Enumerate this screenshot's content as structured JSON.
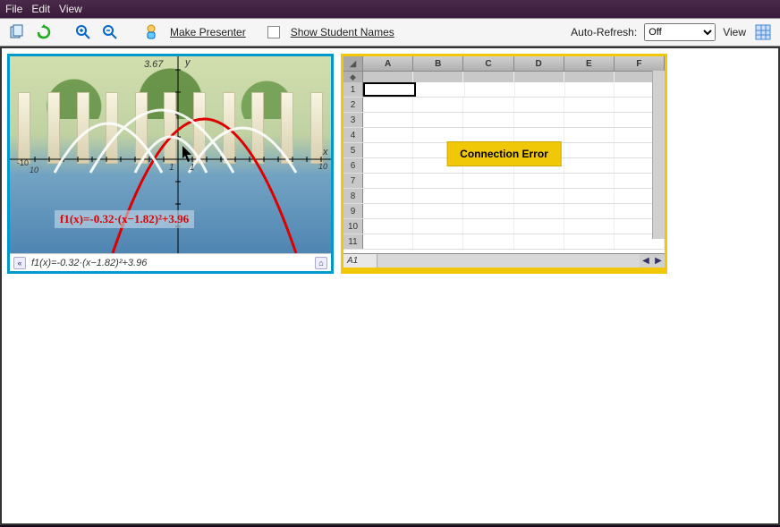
{
  "menu": {
    "file": "File",
    "edit": "Edit",
    "view": "View"
  },
  "toolbar": {
    "make_presenter": "Make Presenter",
    "show_student_names": "Show Student Names",
    "auto_refresh_label": "Auto-Refresh:",
    "auto_refresh_value": "Off",
    "view_label": "View"
  },
  "graph": {
    "equation_display": "f1(x)=-0.32·(x−1.82)²+3.96",
    "footer_equation": "f1(x)=-0.32·(x−1.82)²+3.96",
    "y_top_label": "3.67",
    "y_axis_label": "y",
    "x_axis_label": "x",
    "x_min_label": "-10",
    "x_min_label2": "10",
    "x_max_label": "10",
    "tick_label": "1"
  },
  "spreadsheet": {
    "columns": [
      "A",
      "B",
      "C",
      "D",
      "E",
      "F"
    ],
    "rows": [
      "1",
      "2",
      "3",
      "4",
      "5",
      "6",
      "7",
      "8",
      "9",
      "10",
      "11"
    ],
    "selected_cell_ref": "A1",
    "error_message": "Connection Error"
  },
  "chart_data": {
    "type": "line",
    "title": "",
    "xlabel": "x",
    "ylabel": "y",
    "xlim": [
      -10,
      10
    ],
    "ylim": [
      -3,
      4
    ],
    "series": [
      {
        "name": "f1(x) = -0.32·(x−1.82)² + 3.96",
        "color": "#d00000",
        "x": [
          -2,
          -1,
          0,
          1,
          1.82,
          2,
          3,
          4,
          5,
          6
        ],
        "y": [
          -0.71,
          1.41,
          2.9,
          3.74,
          3.96,
          3.95,
          3.51,
          2.44,
          0.72,
          -1.63
        ]
      }
    ],
    "annotations": [
      {
        "text": "3.67",
        "x": 0,
        "y": 3.67
      },
      {
        "text": "1",
        "x": 1,
        "y": 0
      }
    ]
  }
}
